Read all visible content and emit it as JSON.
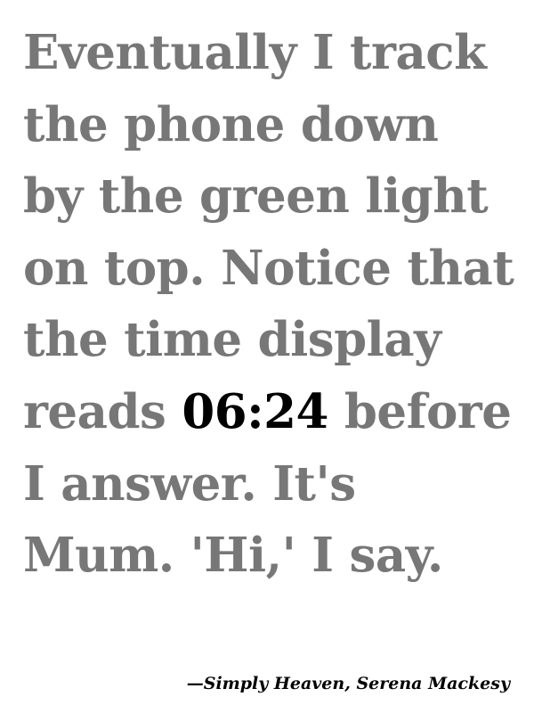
{
  "quote": {
    "lines": [
      "Eventually I track",
      "the phone down",
      "by the green light",
      "on top. Notice that",
      "the time display"
    ],
    "line6_before": "reads ",
    "time": "06:24",
    "line6_after": " before",
    "lines_after": [
      "I answer. It's",
      "Mum. 'Hi,' I say."
    ]
  },
  "attribution": "—Simply Heaven, Serena Mackesy",
  "colors": {
    "text": "#777777",
    "highlight": "#000000",
    "background": "#ffffff"
  }
}
